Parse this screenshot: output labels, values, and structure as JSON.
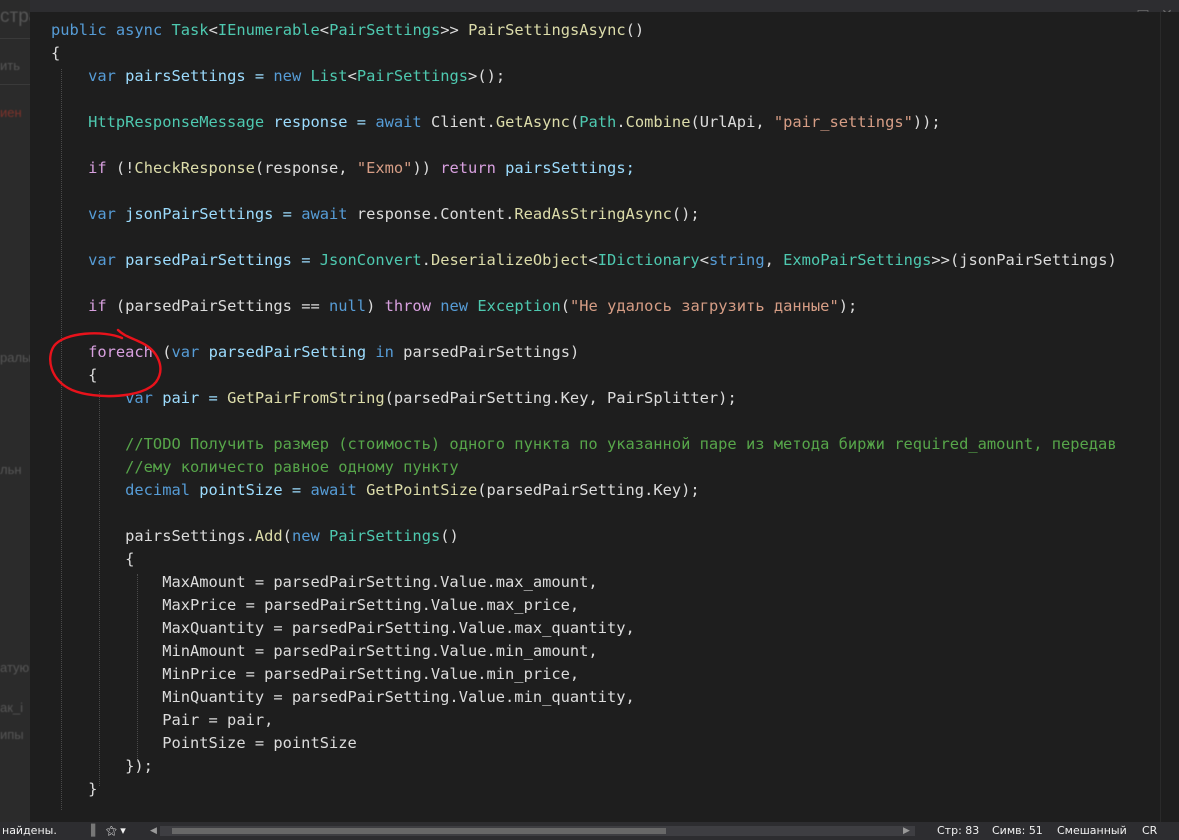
{
  "background_app": {
    "title_fragment": "стра гео",
    "fragments": [
      "ить",
      "иен",
      "ралы",
      "льн",
      "атую",
      "ак_i",
      "ипы"
    ]
  },
  "window_buttons": [
    "□",
    "✕"
  ],
  "code_lines": [
    [
      {
        "t": "public ",
        "c": "kw"
      },
      {
        "t": "async ",
        "c": "kw"
      },
      {
        "t": "Task",
        "c": "ty"
      },
      {
        "t": "<",
        "c": ""
      },
      {
        "t": "IEnumerable",
        "c": "ty"
      },
      {
        "t": "<",
        "c": ""
      },
      {
        "t": "PairSettings",
        "c": "ty"
      },
      {
        "t": ">> ",
        "c": ""
      },
      {
        "t": "PairSettingsAsync",
        "c": "fn"
      },
      {
        "t": "()",
        "c": ""
      }
    ],
    [
      {
        "t": "{",
        "c": ""
      }
    ],
    [
      {
        "t": "    var ",
        "c": "kw"
      },
      {
        "t": "pairsSettings = ",
        "c": "vr"
      },
      {
        "t": "new ",
        "c": "kw"
      },
      {
        "t": "List",
        "c": "ty"
      },
      {
        "t": "<",
        "c": ""
      },
      {
        "t": "PairSettings",
        "c": "ty"
      },
      {
        "t": ">();",
        "c": ""
      }
    ],
    [],
    [
      {
        "t": "    HttpResponseMessage ",
        "c": "ty"
      },
      {
        "t": "response = ",
        "c": "vr"
      },
      {
        "t": "await ",
        "c": "kw"
      },
      {
        "t": "Client.",
        "c": ""
      },
      {
        "t": "GetAsync",
        "c": "fn"
      },
      {
        "t": "(",
        "c": ""
      },
      {
        "t": "Path",
        "c": "ty"
      },
      {
        "t": ".",
        "c": ""
      },
      {
        "t": "Combine",
        "c": "fn"
      },
      {
        "t": "(UrlApi, ",
        "c": ""
      },
      {
        "t": "\"pair_settings\"",
        "c": "str"
      },
      {
        "t": "));",
        "c": ""
      }
    ],
    [],
    [
      {
        "t": "    if ",
        "c": "ctl"
      },
      {
        "t": "(!",
        "c": ""
      },
      {
        "t": "CheckResponse",
        "c": "fn"
      },
      {
        "t": "(response, ",
        "c": ""
      },
      {
        "t": "\"Exmo\"",
        "c": "str"
      },
      {
        "t": ")) ",
        "c": ""
      },
      {
        "t": "return ",
        "c": "ctl"
      },
      {
        "t": "pairsSettings;",
        "c": "vr"
      }
    ],
    [],
    [
      {
        "t": "    var ",
        "c": "kw"
      },
      {
        "t": "jsonPairSettings = ",
        "c": "vr"
      },
      {
        "t": "await ",
        "c": "kw"
      },
      {
        "t": "response.Content.",
        "c": ""
      },
      {
        "t": "ReadAsStringAsync",
        "c": "fn"
      },
      {
        "t": "();",
        "c": ""
      }
    ],
    [],
    [
      {
        "t": "    var ",
        "c": "kw"
      },
      {
        "t": "parsedPairSettings = ",
        "c": "vr"
      },
      {
        "t": "JsonConvert",
        "c": "ty"
      },
      {
        "t": ".",
        "c": ""
      },
      {
        "t": "DeserializeObject",
        "c": "fn"
      },
      {
        "t": "<",
        "c": ""
      },
      {
        "t": "IDictionary",
        "c": "ty"
      },
      {
        "t": "<",
        "c": ""
      },
      {
        "t": "string",
        "c": "kw"
      },
      {
        "t": ", ",
        "c": ""
      },
      {
        "t": "ExmoPairSettings",
        "c": "ty"
      },
      {
        "t": ">>(jsonPairSettings)",
        "c": ""
      }
    ],
    [],
    [
      {
        "t": "    if ",
        "c": "ctl"
      },
      {
        "t": "(parsedPairSettings == ",
        "c": ""
      },
      {
        "t": "null",
        "c": "kw"
      },
      {
        "t": ") ",
        "c": ""
      },
      {
        "t": "throw ",
        "c": "ctl"
      },
      {
        "t": "new ",
        "c": "kw"
      },
      {
        "t": "Exception",
        "c": "ty"
      },
      {
        "t": "(",
        "c": ""
      },
      {
        "t": "\"Не удалось загрузить данные\"",
        "c": "str"
      },
      {
        "t": ");",
        "c": ""
      }
    ],
    [],
    [
      {
        "t": "    foreach ",
        "c": "ctl"
      },
      {
        "t": "(",
        "c": ""
      },
      {
        "t": "var ",
        "c": "kw"
      },
      {
        "t": "parsedPairSetting ",
        "c": "vr"
      },
      {
        "t": "in ",
        "c": "kw"
      },
      {
        "t": "parsedPairSettings)",
        "c": ""
      }
    ],
    [
      {
        "t": "    {",
        "c": ""
      }
    ],
    [
      {
        "t": "        var ",
        "c": "kw"
      },
      {
        "t": "pair = ",
        "c": "vr"
      },
      {
        "t": "GetPairFromString",
        "c": "fn"
      },
      {
        "t": "(parsedPairSetting.Key, PairSplitter);",
        "c": ""
      }
    ],
    [],
    [
      {
        "t": "        //TODO Получить размер (стоимость) одного пункта по указанной паре из метода биржи required_amount, передав",
        "c": "cm"
      }
    ],
    [
      {
        "t": "        //ему количесто равное одному пункту",
        "c": "cm"
      }
    ],
    [
      {
        "t": "        decimal ",
        "c": "kw"
      },
      {
        "t": "pointSize = ",
        "c": "vr"
      },
      {
        "t": "await ",
        "c": "kw"
      },
      {
        "t": "GetPointSize",
        "c": "fn"
      },
      {
        "t": "(parsedPairSetting.Key);",
        "c": ""
      }
    ],
    [],
    [
      {
        "t": "        pairsSettings.",
        "c": ""
      },
      {
        "t": "Add",
        "c": "fn"
      },
      {
        "t": "(",
        "c": ""
      },
      {
        "t": "new ",
        "c": "kw"
      },
      {
        "t": "PairSettings",
        "c": "ty"
      },
      {
        "t": "()",
        "c": ""
      }
    ],
    [
      {
        "t": "        {",
        "c": ""
      }
    ],
    [
      {
        "t": "            MaxAmount = parsedPairSetting.Value.max_amount,",
        "c": ""
      }
    ],
    [
      {
        "t": "            MaxPrice = parsedPairSetting.Value.max_price,",
        "c": ""
      }
    ],
    [
      {
        "t": "            MaxQuantity = parsedPairSetting.Value.max_quantity,",
        "c": ""
      }
    ],
    [
      {
        "t": "            MinAmount = parsedPairSetting.Value.min_amount,",
        "c": ""
      }
    ],
    [
      {
        "t": "            MinPrice = parsedPairSetting.Value.min_price,",
        "c": ""
      }
    ],
    [
      {
        "t": "            MinQuantity = parsedPairSetting.Value.min_quantity,",
        "c": ""
      }
    ],
    [
      {
        "t": "            Pair = pair,",
        "c": ""
      }
    ],
    [
      {
        "t": "            PointSize = pointSize",
        "c": ""
      }
    ],
    [
      {
        "t": "        });",
        "c": ""
      }
    ],
    [
      {
        "t": "    }",
        "c": ""
      }
    ]
  ],
  "status_bar": {
    "message": "найдены.",
    "line": "Стр: 83",
    "col": "Симв: 51",
    "mode": "Смешанный",
    "eol": "CR"
  },
  "colors": {
    "keyword": "#569cd6",
    "type": "#4ec9b0",
    "method": "#dcdcaa",
    "string": "#d69d85",
    "comment": "#57a64a",
    "control": "#d8a0df",
    "annotation": "#e8121b"
  }
}
